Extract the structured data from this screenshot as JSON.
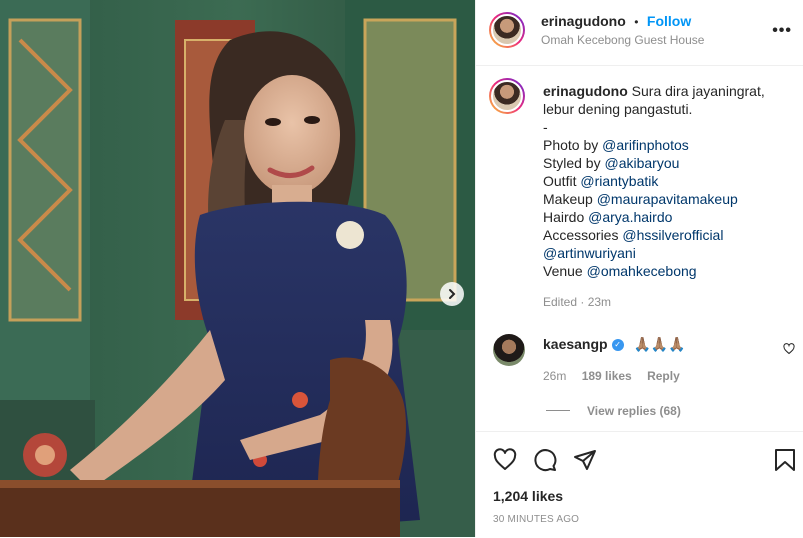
{
  "post": {
    "username": "erinagudono",
    "separator": "•",
    "follow_label": "Follow",
    "location": "Omah Kecebong Guest House",
    "more_label": "•••"
  },
  "caption": {
    "username": "erinagudono",
    "line1": "Sura dira jayaningrat,",
    "line2": "lebur dening pangastuti.",
    "dash": "-",
    "credits": [
      {
        "label": "Photo by ",
        "mention": "@arifinphotos"
      },
      {
        "label": "Styled by ",
        "mention": "@akibaryou"
      },
      {
        "label": "Outfit ",
        "mention": "@riantybatik"
      },
      {
        "label": "Makeup ",
        "mention": "@maurapavitamakeup"
      },
      {
        "label": "Hairdo ",
        "mention": "@arya.hairdo"
      },
      {
        "label": "Accessories ",
        "mention": "@hssilverofficial"
      },
      {
        "label": "",
        "mention": "@artinwuriyani"
      },
      {
        "label": "Venue ",
        "mention": "@omahkecebong"
      }
    ],
    "edited": "Edited · 23m"
  },
  "comment": {
    "username": "kaesangp",
    "text": "🙏🏽🙏🏽🙏🏽",
    "time": "26m",
    "likes": "189 likes",
    "reply_label": "Reply",
    "view_replies": "View replies (68)"
  },
  "footer": {
    "likes": "1,204 likes",
    "timestamp": "30 MINUTES AGO"
  },
  "colors": {
    "link": "#0095f6",
    "mention": "#00376b",
    "muted": "#8e8e8e",
    "verified": "#3897f0"
  },
  "icons": [
    "chevron-right-icon",
    "more-icon",
    "verified-icon",
    "heart-icon",
    "comment-icon",
    "share-icon",
    "bookmark-icon"
  ]
}
